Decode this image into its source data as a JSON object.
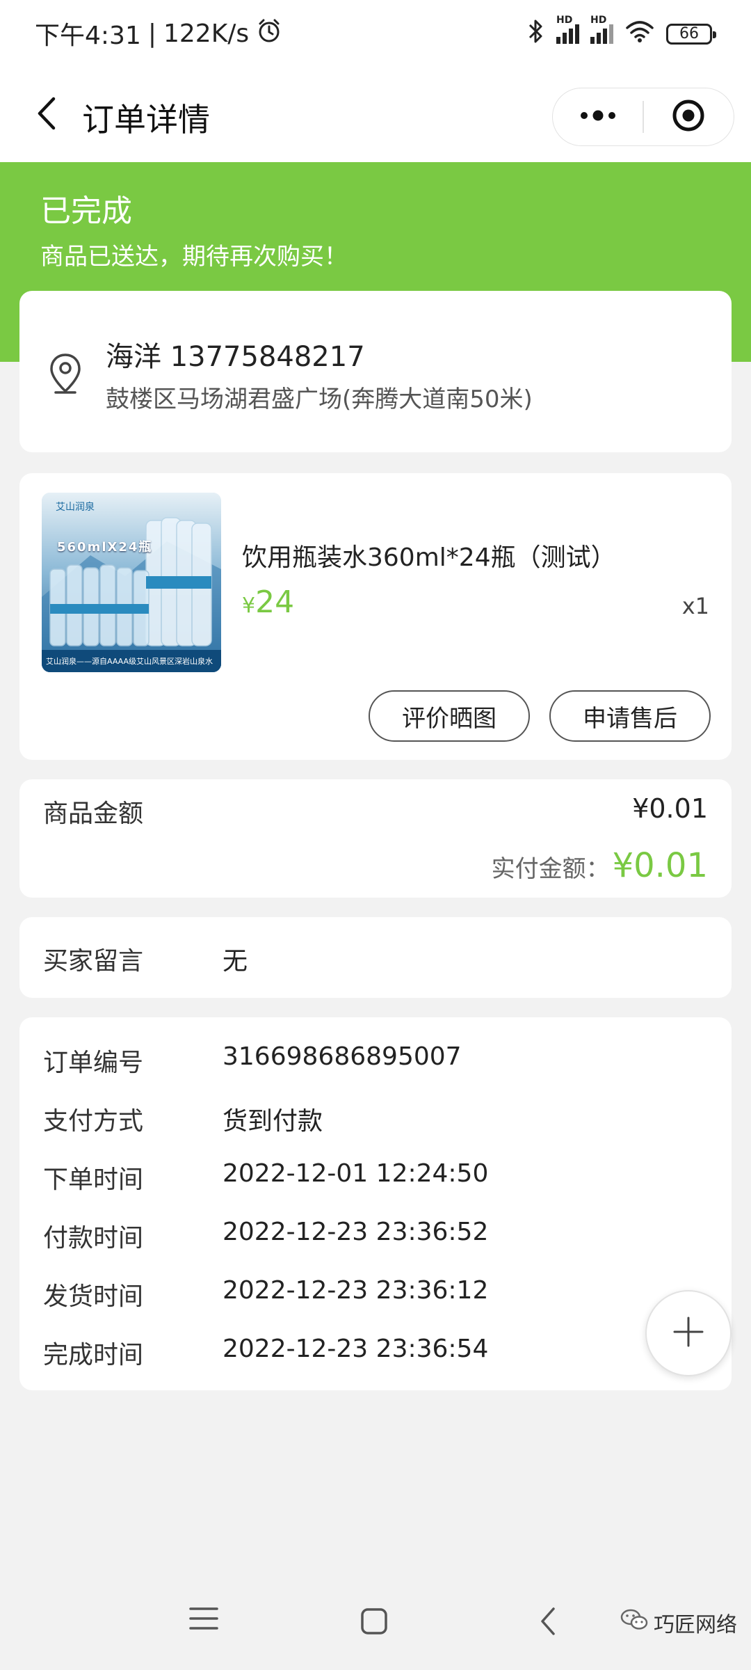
{
  "status_bar": {
    "time": "下午4:31",
    "net_speed": "122K/s",
    "separator": "|",
    "signal1": "HD",
    "signal2": "HD",
    "battery": "66"
  },
  "nav": {
    "title": "订单详情"
  },
  "banner": {
    "status": "已完成",
    "subtitle": "商品已送达，期待再次购买！",
    "color": "#7ac943"
  },
  "address": {
    "name_phone": "海洋 13775848217",
    "detail": "鼓楼区马场湖君盛广场(奔腾大道南50米)"
  },
  "product": {
    "name": "饮用瓶装水360ml*24瓶（测试）",
    "price_symbol": "¥",
    "price": "24",
    "quantity": "x1",
    "image_top_text": "560mlX24瓶",
    "image_brand": "艾山润泉",
    "image_bottom_text": "艾山润泉——源自AAAA级艾山风景区深岩山泉水",
    "review_button": "评价晒图",
    "aftersale_button": "申请售后"
  },
  "amount": {
    "goods_label": "商品金额",
    "goods_value": "¥0.01",
    "paid_label": "实付金额：",
    "paid_value": "¥0.01"
  },
  "message": {
    "label": "买家留言",
    "value": "无"
  },
  "order_info": [
    {
      "label": "订单编号",
      "value": "316698686895007"
    },
    {
      "label": "支付方式",
      "value": "货到付款"
    },
    {
      "label": "下单时间",
      "value": "2022-12-01 12:24:50"
    },
    {
      "label": "付款时间",
      "value": "2022-12-23 23:36:52"
    },
    {
      "label": "发货时间",
      "value": "2022-12-23 23:36:12"
    },
    {
      "label": "完成时间",
      "value": "2022-12-23 23:36:54"
    }
  ],
  "watermark": "巧匠网络",
  "icons": [
    "alarm-icon",
    "bluetooth-icon",
    "signal-icon",
    "wifi-icon",
    "battery-icon",
    "back-arrow-icon",
    "more-dots-icon",
    "close-target-icon",
    "location-pin-icon",
    "plus-icon",
    "menu-icon",
    "home-icon",
    "chevron-left-icon",
    "wechat-icon"
  ],
  "colors": {
    "accent": "#7ac943",
    "background": "#f2f2f2",
    "card": "#ffffff"
  }
}
